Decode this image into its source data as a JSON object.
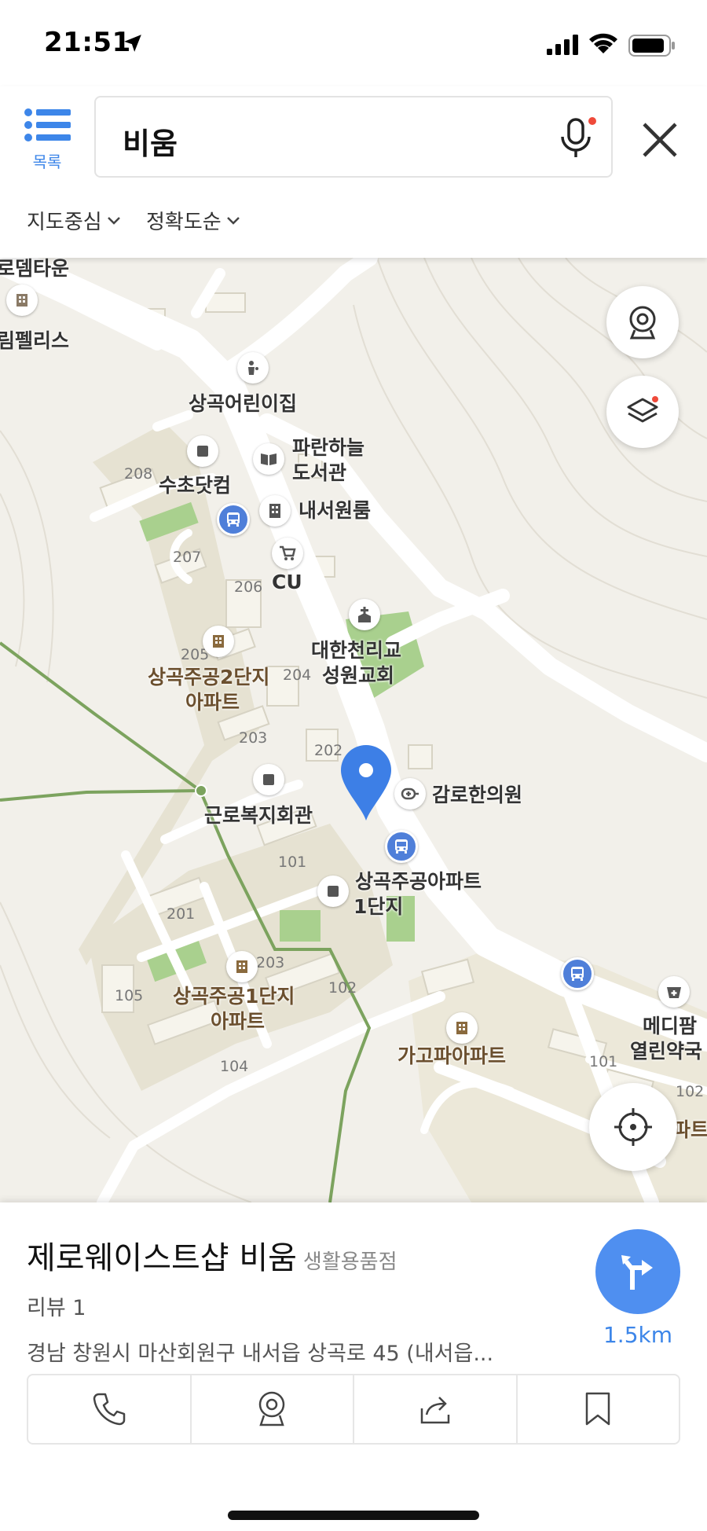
{
  "status": {
    "time": "21:51"
  },
  "header": {
    "list_label": "목록",
    "search_value": "비움",
    "filters": [
      {
        "label": "지도중심"
      },
      {
        "label": "정확도순"
      }
    ]
  },
  "map": {
    "labels": {
      "top_left_1": "로뎀타운",
      "top_left_2": "림펠리스",
      "daycare": "상곡어린이집",
      "library_1": "파란하늘",
      "library_2": "도서관",
      "sucho": "수초닷컴",
      "naeseo": "내서원룸",
      "cu": "CU",
      "church_1": "대한천리교",
      "church_2": "성원교회",
      "apt2_1": "상곡주공2단지",
      "apt2_2": "아파트",
      "hall": "근로복지회관",
      "clinic": "감로한의원",
      "apt1_bus_1": "상곡주공아파트",
      "apt1_bus_2": "1단지",
      "apt1_1": "상곡주공1단지",
      "apt1_2": "아파트",
      "gago": "가고파아파트",
      "pharm_1": "메디팜",
      "pharm_2": "열린약국",
      "right_apt": "파트"
    },
    "numbers": [
      "208",
      "207",
      "206",
      "205",
      "204",
      "203",
      "202",
      "101",
      "201",
      "203",
      "105",
      "102",
      "104",
      "101",
      "102"
    ]
  },
  "card": {
    "name": "제로웨이스트샵 비움",
    "category": "생활용품점",
    "review": "리뷰 1",
    "address": "경남 창원시 마산회원구 내서읍 상곡로 45 (내서읍...",
    "distance": "1.5km"
  },
  "colors": {
    "accent": "#4f8ff0",
    "road": "#ffffff",
    "land": "#f2f0ea",
    "apt_block": "#e4e0cf",
    "park": "#92c47a",
    "trail": "#7ca35e"
  }
}
